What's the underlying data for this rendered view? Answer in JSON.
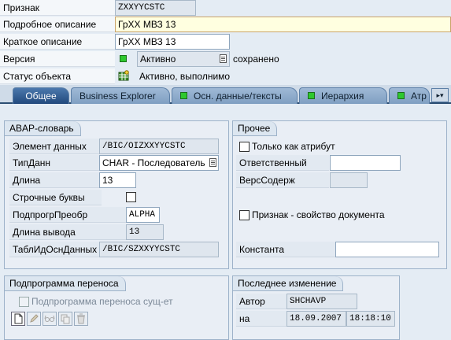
{
  "header": {
    "priznak_label": "Признак",
    "priznak_value": "ZXXYYCSTC",
    "full_desc_label": "Подробное описание",
    "full_desc_value": "ГрХХ МВЗ 13",
    "short_desc_label": "Краткое описание",
    "short_desc_value": "ГрХХ МВЗ 13",
    "version_label": "Версия",
    "version_value": "Активно",
    "version_status": "сохранено",
    "object_status_label": "Статус объекта",
    "object_status_value": "Активно, выполнимо"
  },
  "tabs": [
    {
      "label": "Общее",
      "active": true
    },
    {
      "label": "Business Explorer",
      "active": false
    },
    {
      "label": "Осн. данные/тексты",
      "active": false,
      "lamp": true
    },
    {
      "label": "Иерархия",
      "active": false,
      "lamp": true
    },
    {
      "label": "Атр",
      "active": false,
      "lamp": true
    }
  ],
  "abap": {
    "title": "ABAP-словарь",
    "data_element_label": "Элемент данных",
    "data_element_value": "/BIC/OIZXXYYCSTC",
    "datatype_label": "ТипДанн",
    "datatype_value": "CHAR - Последователь",
    "length_label": "Длина",
    "length_value": "13",
    "lowercase_label": "Строчные буквы",
    "conv_routine_label": "ПодпрогрПреобр",
    "conv_routine_value": "ALPHA",
    "output_length_label": "Длина вывода",
    "output_length_value": "13",
    "sid_table_label": "ТаблИдОснДанных",
    "sid_table_value": "/BIC/SZXXYYCSTC"
  },
  "other": {
    "title": "Прочее",
    "attr_only_label": "Только как атрибут",
    "responsible_label": "Ответственный",
    "content_version_label": "ВерсСодерж",
    "doc_property_label": "Признак - свойство документа",
    "constant_label": "Константа"
  },
  "transfer": {
    "title": "Подпрограмма переноса",
    "exists_label": "Подпрограмма переноса сущ-ет"
  },
  "last_change": {
    "title": "Последнее изменение",
    "author_label": "Автор",
    "author_value": "SHCHAVP",
    "on_label": "на",
    "date_value": "18.09.2007",
    "time_value": "18:18:10"
  },
  "colors": {
    "background": "#e4ecf4",
    "tab_active": "#21497c",
    "status_green": "#2ec82e"
  }
}
